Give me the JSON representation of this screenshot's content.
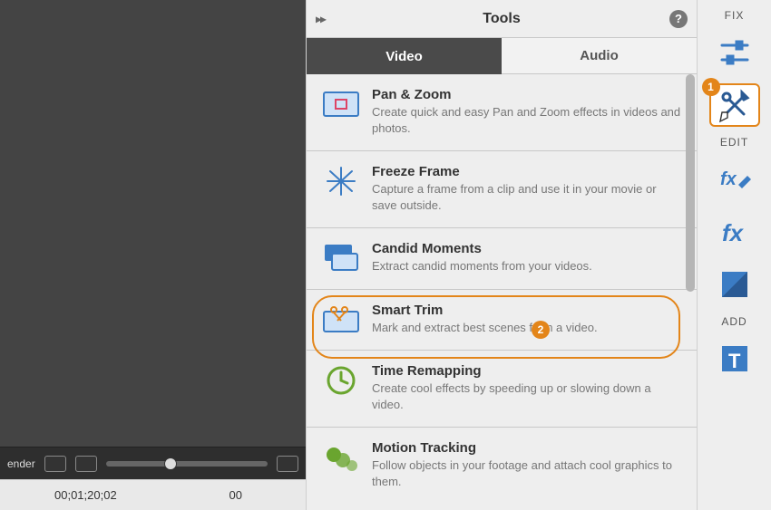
{
  "viewer": {
    "render_label": "ender",
    "timecode_left": "00;01;20;02",
    "timecode_right": "00"
  },
  "panel": {
    "title": "Tools",
    "tabs": {
      "video": "Video",
      "audio": "Audio"
    },
    "tools": [
      {
        "title": "Pan & Zoom",
        "desc": "Create quick and easy Pan and Zoom effects in videos and photos."
      },
      {
        "title": "Freeze Frame",
        "desc": "Capture a frame from a clip and use it in your movie or save outside."
      },
      {
        "title": "Candid Moments",
        "desc": "Extract candid moments from your videos."
      },
      {
        "title": "Smart Trim",
        "desc": "Mark and extract best scenes from a video."
      },
      {
        "title": "Time Remapping",
        "desc": "Create cool effects by speeding up or slowing down a video."
      },
      {
        "title": "Motion Tracking",
        "desc": "Follow objects in your footage and attach cool graphics to them."
      }
    ]
  },
  "rail": {
    "fix": "FIX",
    "edit": "EDIT",
    "add": "ADD"
  },
  "callouts": {
    "one": "1",
    "two": "2"
  }
}
